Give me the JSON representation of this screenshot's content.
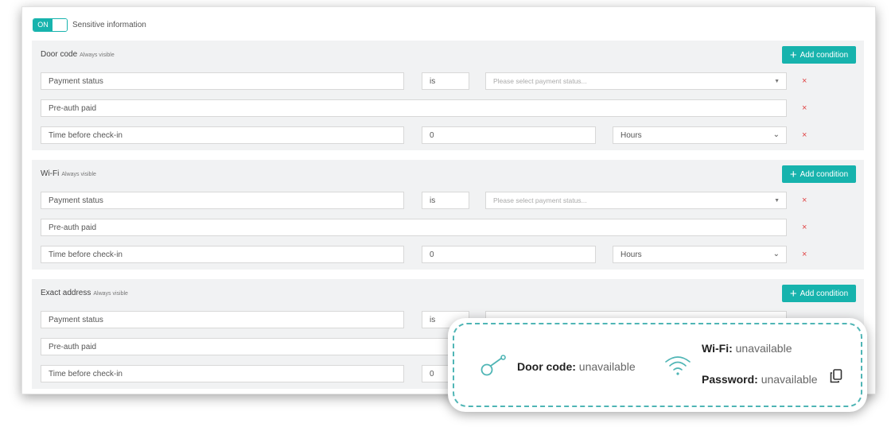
{
  "toggle": {
    "state_label": "ON",
    "label": "Sensitive information"
  },
  "sections": [
    {
      "title": "Door code",
      "visibility": "Always visible",
      "add_label": "Add condition",
      "rows": [
        {
          "field": "Payment status",
          "operator": "is",
          "value": "Please select payment status..."
        },
        {
          "field": "Pre-auth paid"
        },
        {
          "field": "Time before check-in",
          "value": "0",
          "unit": "Hours"
        }
      ]
    },
    {
      "title": "Wi-Fi",
      "visibility": "Always visible",
      "add_label": "Add condition",
      "rows": [
        {
          "field": "Payment status",
          "operator": "is",
          "value": "Please select payment status..."
        },
        {
          "field": "Pre-auth paid"
        },
        {
          "field": "Time before check-in",
          "value": "0",
          "unit": "Hours"
        }
      ]
    },
    {
      "title": "Exact address",
      "visibility": "Always visible",
      "add_label": "Add condition",
      "rows": [
        {
          "field": "Payment status",
          "operator": "is"
        },
        {
          "field": "Pre-auth paid"
        },
        {
          "field": "Time before check-in",
          "value": "0"
        }
      ]
    }
  ],
  "callout": {
    "door_code_label": "Door code:",
    "door_code_value": "unavailable",
    "wifi_label": "Wi-Fi:",
    "wifi_value": "unavailable",
    "password_label": "Password:",
    "password_value": "unavailable",
    "accent_color": "#4fb5b5"
  },
  "colors": {
    "accent": "#17b3ad",
    "remove": "#e04545",
    "section_bg": "#f1f2f3"
  },
  "icons": {
    "remove": "×",
    "plus": "+",
    "caret": "▼",
    "chevron": "⌄"
  }
}
